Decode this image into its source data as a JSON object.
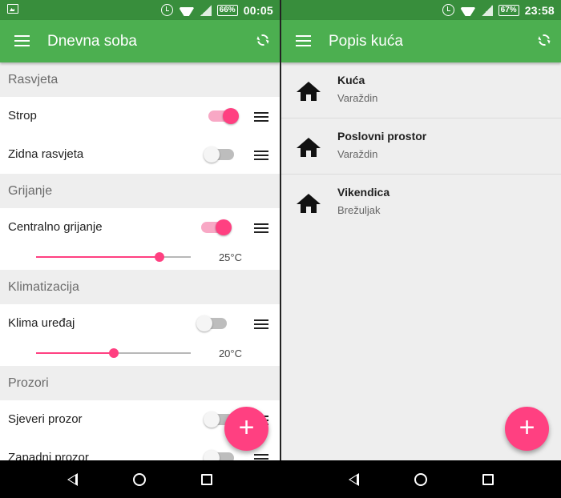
{
  "left_screen": {
    "status_bar": {
      "battery": "66%",
      "time": "00:05"
    },
    "app_bar": {
      "title": "Dnevna soba",
      "menu_icon": "menu-icon",
      "refresh_icon": "refresh-icon"
    },
    "sections": [
      {
        "title": "Rasvjeta",
        "devices": [
          {
            "label": "Strop",
            "on": true
          },
          {
            "label": "Zidna rasvjeta",
            "on": false
          }
        ]
      },
      {
        "title": "Grijanje",
        "devices": [
          {
            "label": "Centralno grijanje",
            "on": true,
            "slider_value_text": "25°C",
            "slider_level": 0.8
          }
        ]
      },
      {
        "title": "Klimatizacija",
        "devices": [
          {
            "label": "Klima uređaj",
            "on": false,
            "slider_value_text": "20°C",
            "slider_level": 0.5
          }
        ]
      },
      {
        "title": "Prozori",
        "devices": [
          {
            "label": "Sjeveri prozor",
            "on": false
          },
          {
            "label": "Zapadni prozor",
            "on": false
          }
        ]
      }
    ],
    "fab": {
      "label": "+"
    }
  },
  "right_screen": {
    "status_bar": {
      "battery": "67%",
      "time": "23:58"
    },
    "app_bar": {
      "title": "Popis kuća",
      "menu_icon": "menu-icon",
      "refresh_icon": "refresh-icon"
    },
    "houses": [
      {
        "name": "Kuća",
        "city": "Varaždin",
        "icon": "house-icon"
      },
      {
        "name": "Poslovni prostor",
        "city": "Varaždin",
        "icon": "house-icon"
      },
      {
        "name": "Vikendica",
        "city": "Brežuljak",
        "icon": "house-icon"
      }
    ],
    "fab": {
      "label": "+"
    }
  },
  "colors": {
    "status_bar": "#388e3c",
    "app_bar": "#4caf50",
    "accent": "#ff4081",
    "background": "#eeeeee"
  }
}
